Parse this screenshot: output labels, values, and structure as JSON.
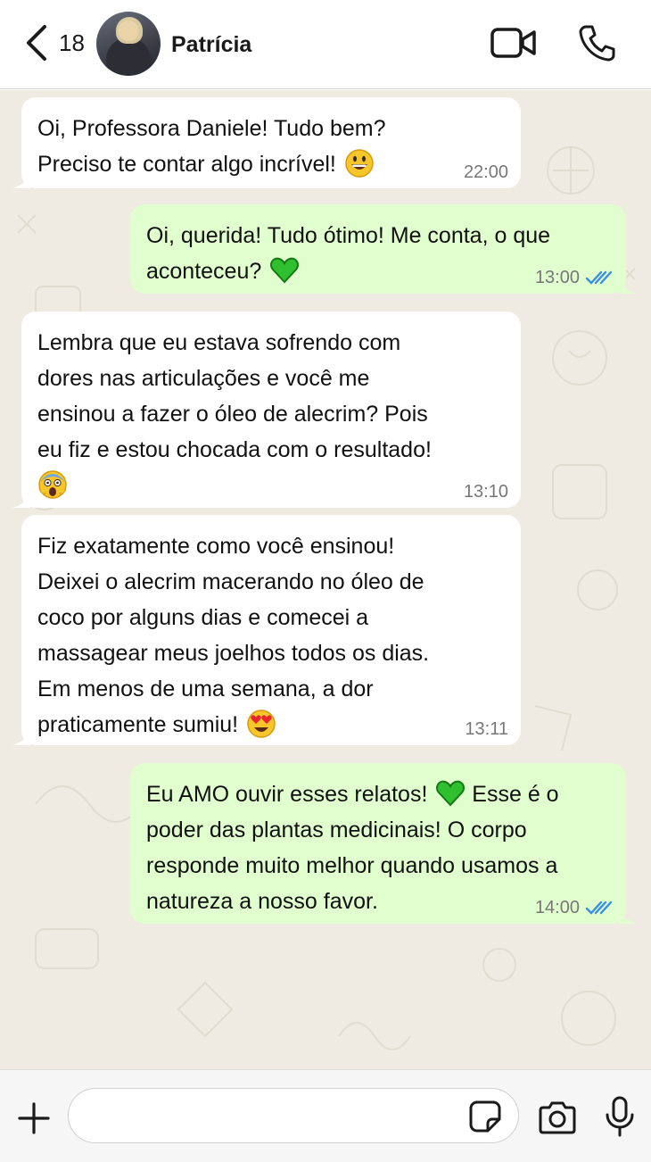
{
  "header": {
    "unread_count": "18",
    "contact_name": "Patrícia"
  },
  "messages": [
    {
      "direction": "in",
      "lines": [
        "Oi, Professora Daniele! Tudo bem?",
        "Preciso te contar algo incrível!"
      ],
      "emoji": "grinning-face",
      "time": "22:00"
    },
    {
      "direction": "out",
      "lines": [
        "Oi, querida! Tudo ótimo! Me conta, o que",
        "aconteceu?"
      ],
      "emoji": "green-heart",
      "time": "13:00",
      "status": "read"
    },
    {
      "direction": "in",
      "lines": [
        "Lembra que eu estava sofrendo com",
        "dores nas articulações e você me",
        "ensinou a fazer o óleo de alecrim? Pois",
        "eu fiz e estou chocada com o resultado!"
      ],
      "emoji": "face-screaming-in-fear",
      "time": "13:10"
    },
    {
      "direction": "in",
      "lines": [
        "Fiz exatamente como você ensinou!",
        "Deixei o alecrim macerando no óleo de",
        "coco por alguns dias e comecei a",
        "massagear meus joelhos todos os dias.",
        "Em menos de uma semana, a dor",
        "praticamente sumiu!"
      ],
      "emoji": "heart-eyes",
      "time": "13:11"
    },
    {
      "direction": "out",
      "lines": [
        "Eu AMO ouvir esses relatos!",
        "poder das plantas medicinais! O corpo",
        "responde muito melhor quando usamos a",
        "natureza a nosso favor."
      ],
      "line1_after_emoji": " Esse é o",
      "emoji": "green-heart",
      "time": "14:00",
      "status": "read"
    }
  ],
  "composer": {
    "placeholder": ""
  },
  "colors": {
    "incoming_bubble": "#ffffff",
    "outgoing_bubble": "#e1fecf",
    "chat_background": "#efeae2",
    "read_ticks": "#3b8ee8",
    "heart": "#2fbf2f"
  }
}
